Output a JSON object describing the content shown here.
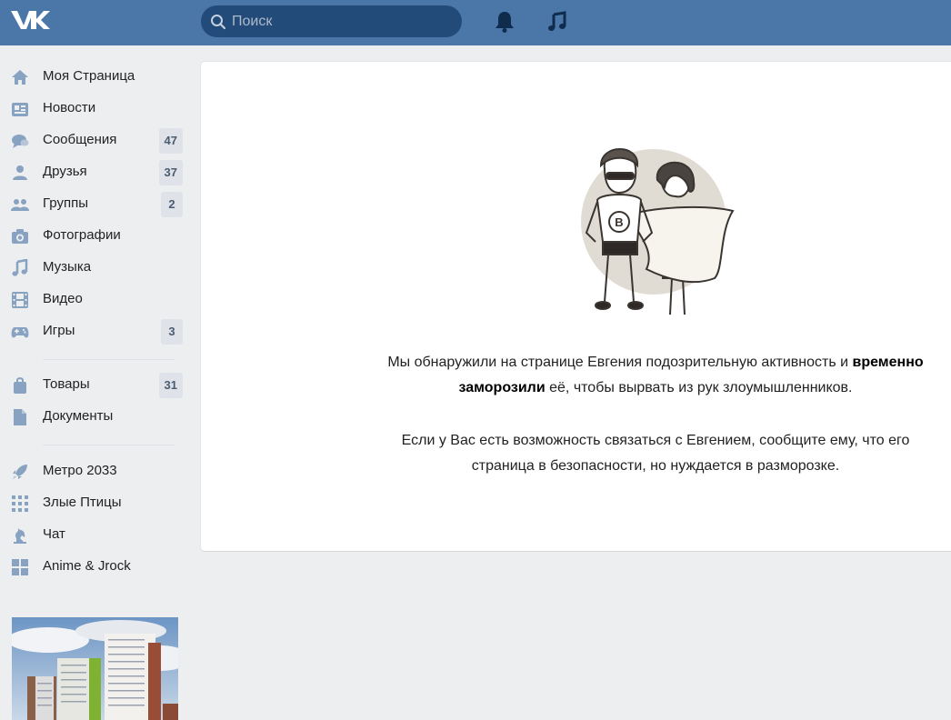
{
  "header": {
    "logo_text": "VK",
    "search": {
      "placeholder": "Поиск",
      "value": ""
    },
    "icons": [
      "bell-icon",
      "music-icon"
    ],
    "bg_color": "#4a76a8"
  },
  "sidebar": {
    "items": [
      {
        "label": "Моя Страница",
        "icon": "home-icon"
      },
      {
        "label": "Новости",
        "icon": "news-icon"
      },
      {
        "label": "Сообщения",
        "icon": "messages-icon",
        "count": "47"
      },
      {
        "label": "Друзья",
        "icon": "friend-icon",
        "count": "37"
      },
      {
        "label": "Группы",
        "icon": "groups-icon",
        "count": "2"
      },
      {
        "label": "Фотографии",
        "icon": "camera-icon"
      },
      {
        "label": "Музыка",
        "icon": "music-note-icon"
      },
      {
        "label": "Видео",
        "icon": "film-icon"
      },
      {
        "label": "Игры",
        "icon": "gamepad-icon",
        "count": "3"
      }
    ],
    "items2": [
      {
        "label": "Товары",
        "icon": "bag-icon",
        "count": "31"
      },
      {
        "label": "Документы",
        "icon": "document-icon"
      }
    ],
    "apps": [
      {
        "label": "Метро 2033",
        "icon": "rocket-icon"
      },
      {
        "label": "Злые Птицы",
        "icon": "grid-dots-icon"
      },
      {
        "label": "Чат",
        "icon": "chess-knight-icon"
      },
      {
        "label": "Anime & Jrock",
        "icon": "tiles-icon"
      }
    ]
  },
  "content": {
    "paragraph1": {
      "before": "Мы обнаружили на странице Евгения подозрительную активность и ",
      "bold1": "временно",
      "bold2": "заморозили",
      "after": " её, чтобы вырвать из рук злоумышленников."
    },
    "paragraph2": {
      "line1": "Если у Вас есть возможность связаться с Евгением, сообщите ему, что его",
      "line2": "страница в безопасности, но нуждается в разморозке."
    },
    "hero_badge_letter": "B"
  }
}
